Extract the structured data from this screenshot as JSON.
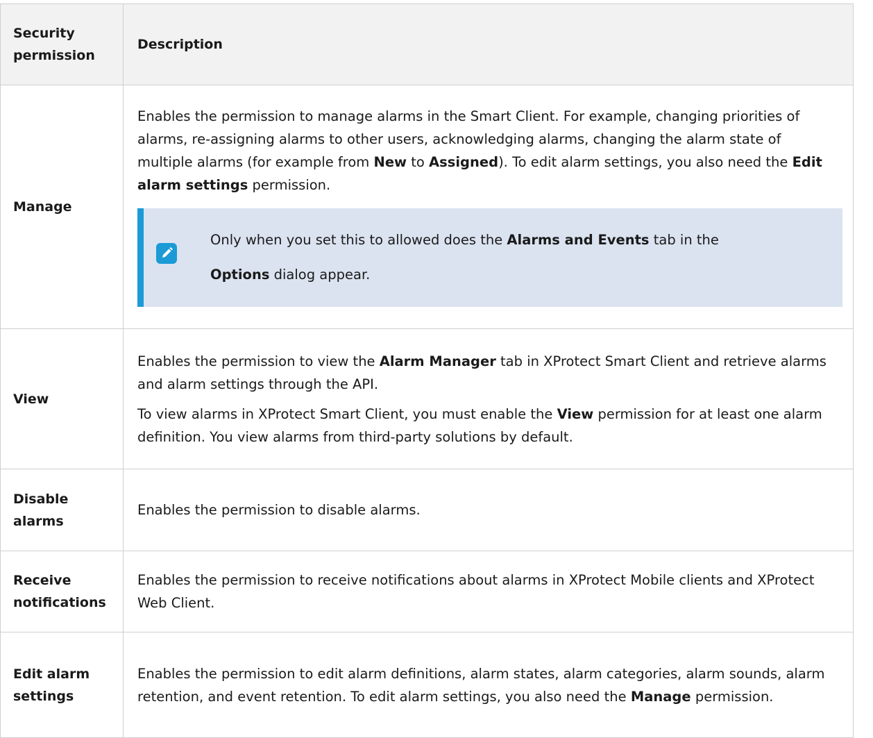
{
  "table": {
    "header": {
      "permission": "Security permission",
      "description": "Description"
    },
    "rows": [
      {
        "permission": "Manage",
        "desc": {
          "t1": "Enables the permission to manage alarms in the Smart Client. For example, changing priorities of alarms, re-assigning alarms to other users, acknowledging alarms, changing the alarm state of multiple alarms (for example from ",
          "b1": "New",
          "t2": " to ",
          "b2": "Assigned",
          "t3": "). To edit alarm settings, you also need the ",
          "b3": "Edit alarm settings",
          "t4": " permission."
        },
        "note": {
          "icon": "pencil-icon",
          "t1": "Only when you set this to allowed does the ",
          "b1": "Alarms and Events",
          "t2": " tab in the ",
          "b2": "Options",
          "t3": " dialog appear."
        }
      },
      {
        "permission": "View",
        "p1": {
          "t1": "Enables the permission to view the ",
          "b1": "Alarm Manager",
          "t2": " tab in XProtect Smart Client and retrieve alarms and alarm settings through the API."
        },
        "p2": {
          "t1": "To view alarms in XProtect Smart Client, you must enable the ",
          "b1": "View",
          "t2": " permission for at least one alarm definition. You view alarms from third-party solutions by default."
        }
      },
      {
        "permission": "Disable alarms",
        "desc": "Enables the permission to disable alarms."
      },
      {
        "permission": "Receive notifications",
        "desc": "Enables the permission to receive notifications about alarms in XProtect Mobile clients and XProtect Web Client."
      },
      {
        "permission": "Edit alarm settings",
        "desc": {
          "t1": "Enables the permission to edit alarm definitions, alarm states, alarm categories, alarm sounds, alarm retention, and event retention. To edit alarm settings, you also need the ",
          "b1": "Manage",
          "t2": " permission."
        }
      }
    ]
  },
  "colors": {
    "note_background": "#dbe3f0",
    "note_accent": "#1c9ad6",
    "header_background": "#f2f2f2",
    "border": "#cfcfcf"
  }
}
